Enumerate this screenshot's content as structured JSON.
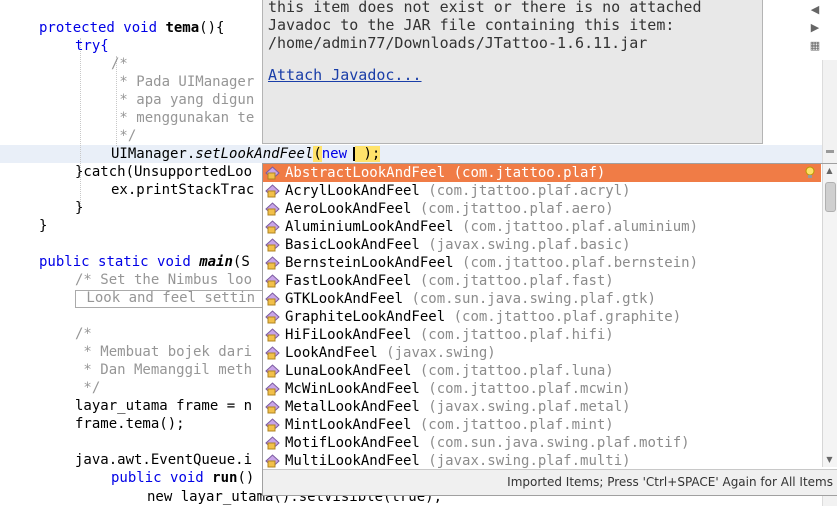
{
  "code": {
    "l1_kw1": "protected",
    "l1_kw2": "void",
    "l1_name": "tema",
    "l1_rest": "(){",
    "l2": "try{",
    "c1": "/*",
    "c2": " * Pada UIManager",
    "c3": " * apa yang digun",
    "c4": " * menggunakan te",
    "c5": " */",
    "l_ui_a": "UIManager.",
    "l_ui_m": "setLookAndFeel",
    "l_ui_b": "(",
    "l_ui_new": "new",
    "l_ui_c": " );",
    "l_catch": "}catch(UnsupportedLoo",
    "l_print": "ex.printStackTrac",
    "l_close1": "}",
    "l_close2": "}",
    "l_main_kw1": "public",
    "l_main_kw2": "static",
    "l_main_kw3": "void",
    "l_main_name": "main",
    "l_main_rest": "(S",
    "c_nimbus": "/* Set the Nimbus loo",
    "c_look": " Look and feel settin",
    "c6": "/*",
    "c7": " * Membuat bojek dari",
    "c8": " * Dan Memanggil meth",
    "c9": " */",
    "l_frame": "layar_utama frame = n",
    "l_tema": "frame.tema();",
    "l_queue": "java.awt.EventQueue.i",
    "l_run_kw1": "public",
    "l_run_kw2": "void",
    "l_run_name": "run",
    "l_run_rest": "()",
    "l_new": "new layar_utama().setVisible(true);"
  },
  "javadoc": {
    "line1": "this item does not exist or there is no attached",
    "line2": "Javadoc to the JAR file containing this item:",
    "line3": "/home/admin77/Downloads/JTattoo-1.6.11.jar",
    "link": "Attach Javadoc..."
  },
  "completion": {
    "items": [
      {
        "name": "AbstractLookAndFeel",
        "pkg": "(com.jtattoo.plaf)"
      },
      {
        "name": "AcrylLookAndFeel",
        "pkg": "(com.jtattoo.plaf.acryl)"
      },
      {
        "name": "AeroLookAndFeel",
        "pkg": "(com.jtattoo.plaf.aero)"
      },
      {
        "name": "AluminiumLookAndFeel",
        "pkg": "(com.jtattoo.plaf.aluminium)"
      },
      {
        "name": "BasicLookAndFeel",
        "pkg": "(javax.swing.plaf.basic)"
      },
      {
        "name": "BernsteinLookAndFeel",
        "pkg": "(com.jtattoo.plaf.bernstein)"
      },
      {
        "name": "FastLookAndFeel",
        "pkg": "(com.jtattoo.plaf.fast)"
      },
      {
        "name": "GTKLookAndFeel",
        "pkg": "(com.sun.java.swing.plaf.gtk)"
      },
      {
        "name": "GraphiteLookAndFeel",
        "pkg": "(com.jtattoo.plaf.graphite)"
      },
      {
        "name": "HiFiLookAndFeel",
        "pkg": "(com.jtattoo.plaf.hifi)"
      },
      {
        "name": "LookAndFeel",
        "pkg": "(javax.swing)"
      },
      {
        "name": "LunaLookAndFeel",
        "pkg": "(com.jtattoo.plaf.luna)"
      },
      {
        "name": "McWinLookAndFeel",
        "pkg": "(com.jtattoo.plaf.mcwin)"
      },
      {
        "name": "MetalLookAndFeel",
        "pkg": "(javax.swing.plaf.metal)"
      },
      {
        "name": "MintLookAndFeel",
        "pkg": "(com.jtattoo.plaf.mint)"
      },
      {
        "name": "MotifLookAndFeel",
        "pkg": "(com.sun.java.swing.plaf.motif)"
      },
      {
        "name": "MultiLookAndFeel",
        "pkg": "(javax.swing.plaf.multi)"
      }
    ],
    "selected_index": 0,
    "footer": "Imported Items; Press 'Ctrl+SPACE' Again for All Items",
    "item_icon": "class-icon",
    "hint_icon": "lightbulb-icon",
    "accent_color": "#f07c46"
  }
}
